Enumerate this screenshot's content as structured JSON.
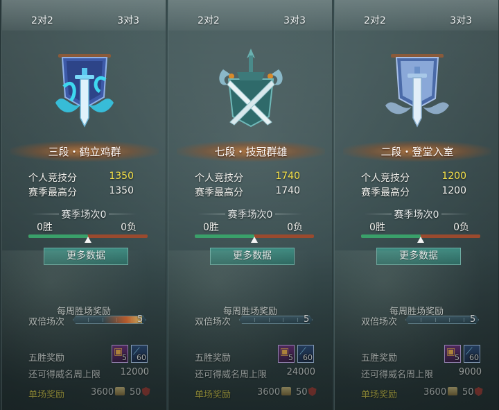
{
  "panels": [
    {
      "tabs": {
        "left": "2对2",
        "right": "3对3"
      },
      "emblem_icon": "banner-sword-icon",
      "rank": "三段・鹤立鸡群",
      "personal_score_label": "个人竞技分",
      "personal_score": "1350",
      "season_high_label": "赛季最高分",
      "season_high": "1350",
      "season_matches": "赛季场次0",
      "wins": "0胜",
      "losses": "0负",
      "win_ratio": 0.5,
      "more_button": "更多数据",
      "weekly_title": "每周胜场奖励",
      "double_label": "双倍场次",
      "double_count": "5",
      "double_fire": true,
      "five_win_label": "五胜奖励",
      "item1_count": "5",
      "item2_count": "60",
      "weekly_limit_label": "还可得威名周上限",
      "weekly_limit": "12000",
      "single_reward_label": "单场奖励",
      "coin": "3600",
      "honor": "50"
    },
    {
      "tabs": {
        "left": "2对2",
        "right": "3对3"
      },
      "emblem_icon": "crossed-swords-crest-icon",
      "rank": "七段・技冠群雄",
      "personal_score_label": "个人竞技分",
      "personal_score": "1740",
      "season_high_label": "赛季最高分",
      "season_high": "1740",
      "season_matches": "赛季场次0",
      "wins": "0胜",
      "losses": "0负",
      "win_ratio": 0.5,
      "more_button": "更多数据",
      "weekly_title": "每周胜场奖励",
      "double_label": "双倍场次",
      "double_count": "5",
      "double_fire": false,
      "five_win_label": "五胜奖励",
      "item1_count": "5",
      "item2_count": "60",
      "weekly_limit_label": "还可得威名周上限",
      "weekly_limit": "24000",
      "single_reward_label": "单场奖励",
      "coin": "3600",
      "honor": "50"
    },
    {
      "tabs": {
        "left": "2对2",
        "right": "3对3"
      },
      "emblem_icon": "banner-sword-icon",
      "rank": "二段・登堂入室",
      "personal_score_label": "个人竞技分",
      "personal_score": "1200",
      "season_high_label": "赛季最高分",
      "season_high": "1200",
      "season_matches": "赛季场次0",
      "wins": "0胜",
      "losses": "0负",
      "win_ratio": 0.5,
      "more_button": "更多数据",
      "weekly_title": "每周胜场奖励",
      "double_label": "双倍场次",
      "double_count": "5",
      "double_fire": false,
      "five_win_label": "五胜奖励",
      "item1_count": "5",
      "item2_count": "60",
      "weekly_limit_label": "还可得威名周上限",
      "weekly_limit": "9000",
      "single_reward_label": "单场奖励",
      "coin": "3600",
      "honor": "50"
    }
  ],
  "colors": {
    "score_highlight": "#f6e24a",
    "single_reward": "#f2e04a",
    "button": "#2a6a62",
    "win_bar": "#3aa06a",
    "loss_bar": "#9a4a2e"
  }
}
